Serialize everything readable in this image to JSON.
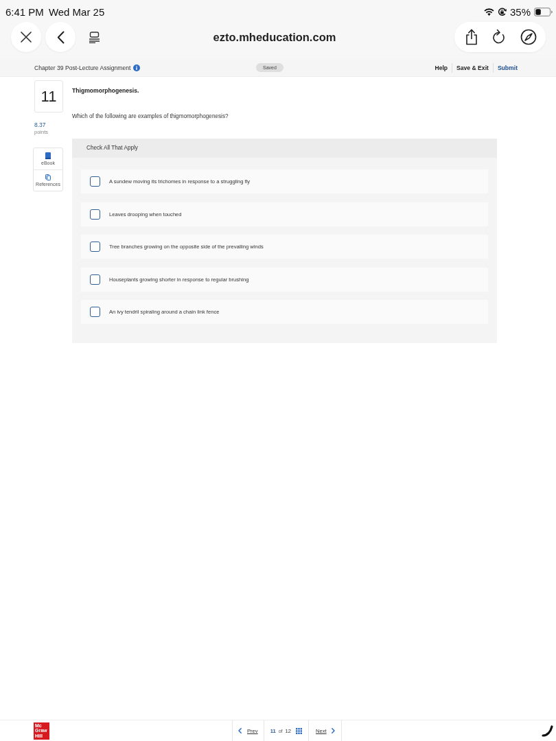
{
  "status_bar": {
    "time": "6:41 PM",
    "date": "Wed Mar 25",
    "battery": "35%"
  },
  "browser": {
    "url": "ezto.mheducation.com"
  },
  "assignment_bar": {
    "title": "Chapter 39 Post-Lecture Assignment",
    "save_status": "Saved",
    "links": [
      {
        "label": "Help",
        "kind": "plain"
      },
      {
        "label": "Save & Exit",
        "kind": "plain"
      },
      {
        "label": "Submit",
        "kind": "primary"
      }
    ]
  },
  "question": {
    "number": "11",
    "points": "8.37",
    "points_label": "points",
    "tools": [
      {
        "label": "eBook",
        "kind": "ebook"
      },
      {
        "label": "References",
        "kind": "references"
      }
    ],
    "title": "Thigmomorphogenesis.",
    "prompt": "Which of the following are examples of thigmomorphogenesis?",
    "instruction": "Check All That Apply",
    "options": [
      {
        "text": "A sundew moving its trichomes in response to a struggling fly",
        "checked": false
      },
      {
        "text": "Leaves drooping when touched",
        "checked": false
      },
      {
        "text": "Tree branches growing on the opposite side of the prevailing winds",
        "checked": false
      },
      {
        "text": "Houseplants growing shorter in response to regular brushing",
        "checked": false
      },
      {
        "text": "An ivy tendril spiraling around a chain link fence",
        "checked": false
      }
    ]
  },
  "footer": {
    "logo": "Mc Graw Hill",
    "prev": "Prev",
    "current": "11",
    "of": "of",
    "total": "12",
    "next": "Next"
  }
}
